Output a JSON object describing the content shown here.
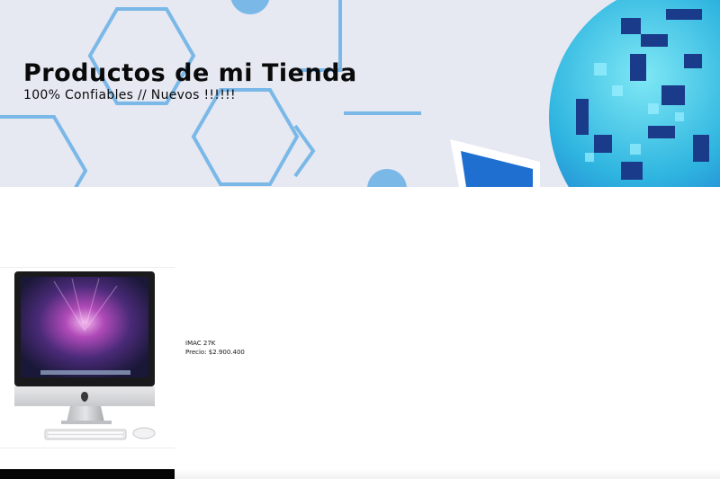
{
  "banner": {
    "title": "Productos de mi Tienda",
    "subtitle": "100% Confiables // Nuevos !!!!!!"
  },
  "products": [
    {
      "name": "IMAC 27K",
      "price": "Precio: $2.900.400",
      "image": "imac-computer-image"
    }
  ],
  "colors": {
    "banner_bg": "#e6e8f2",
    "hex_lines": "#7ab8e8",
    "globe_blue": "#1e6fd0",
    "globe_cyan": "#3fd0e8"
  }
}
